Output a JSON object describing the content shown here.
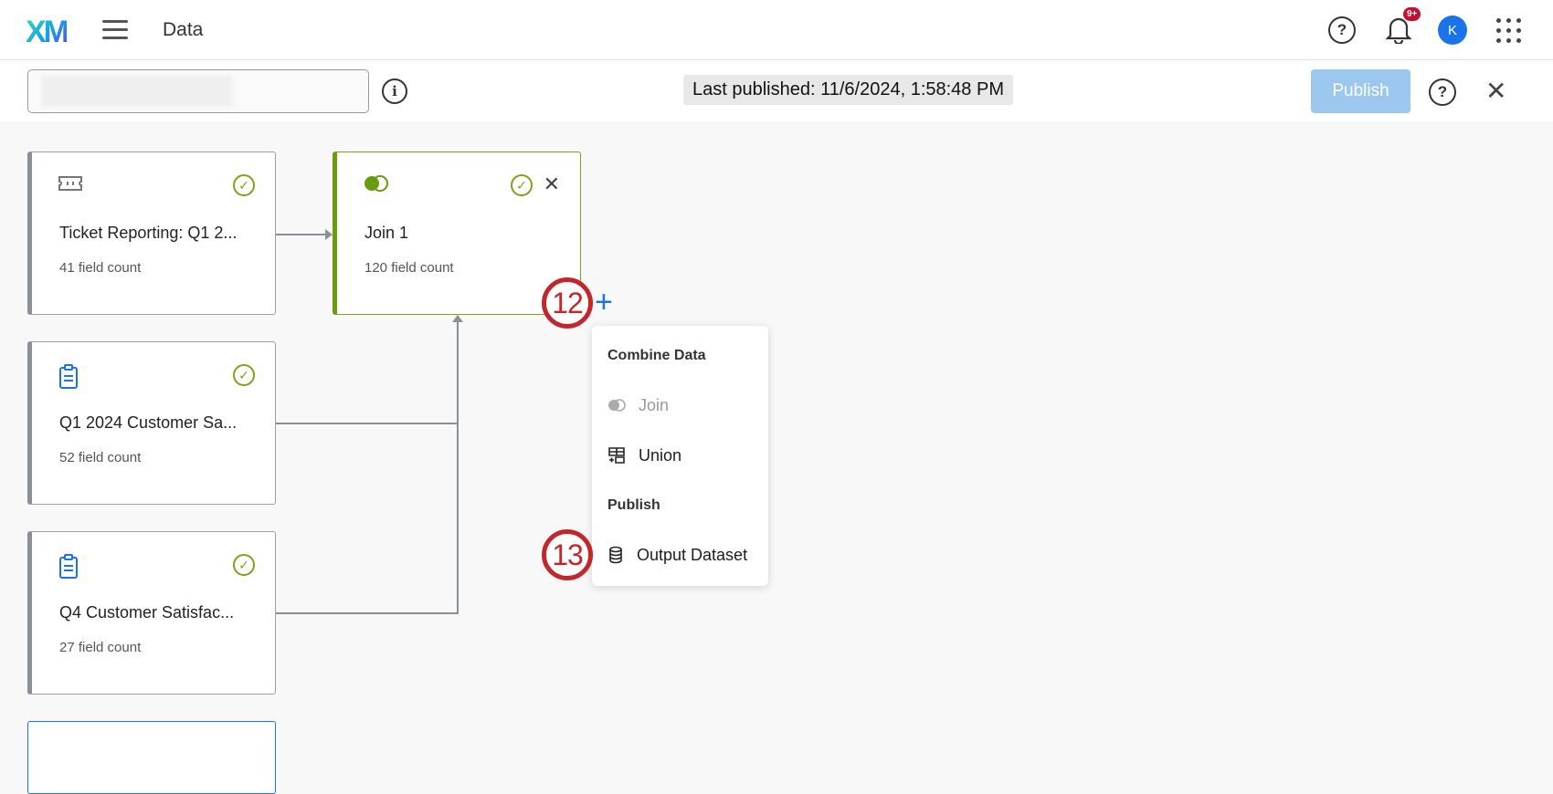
{
  "header": {
    "logo": "XM",
    "title": "Data",
    "notification_count": "9+",
    "avatar_initial": "K"
  },
  "toolbar": {
    "last_published": "Last published: 11/6/2024, 1:58:48 PM",
    "publish_label": "Publish"
  },
  "cards": [
    {
      "name": "Ticket Reporting: Q1 2...",
      "fields": "41 field count"
    },
    {
      "name": "Q1 2024 Customer Sa...",
      "fields": "52 field count"
    },
    {
      "name": "Q4 Customer Satisfac...",
      "fields": "27 field count"
    }
  ],
  "join": {
    "name": "Join 1",
    "fields": "120 field count"
  },
  "annotations": [
    "12",
    "13"
  ],
  "menu": {
    "combine_header": "Combine Data",
    "join": "Join",
    "union": "Union",
    "publish_header": "Publish",
    "output": "Output Dataset"
  },
  "colors": {
    "accent": "#1a73e8",
    "success": "#7aa317",
    "annotation": "#c1272d"
  }
}
